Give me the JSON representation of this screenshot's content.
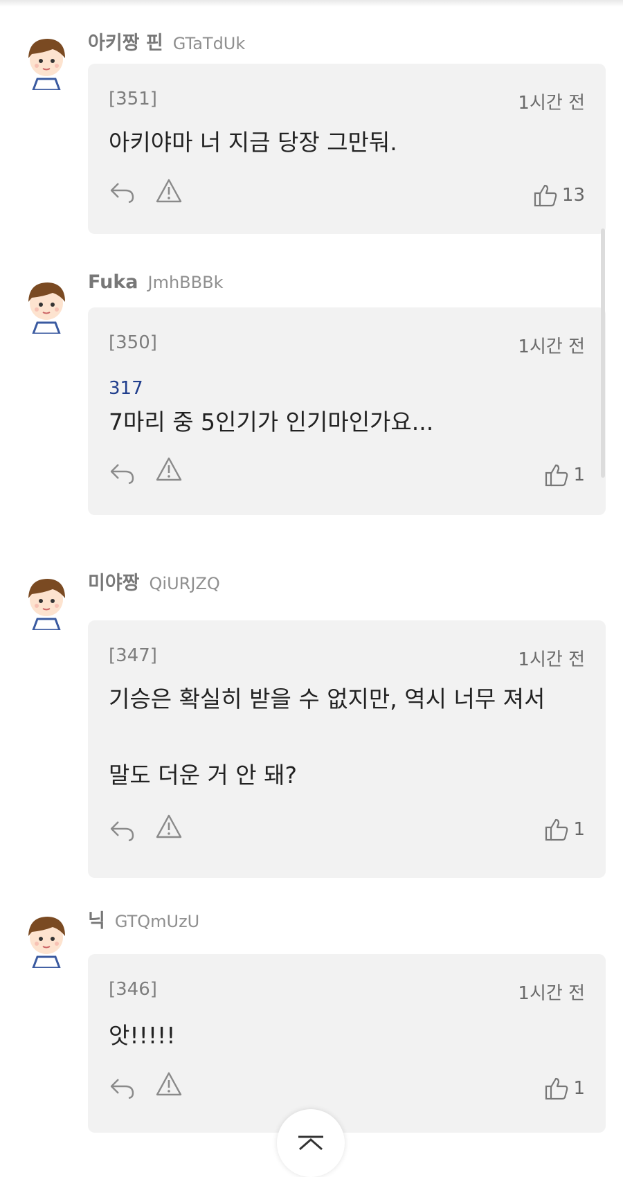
{
  "comments": [
    {
      "nickname": "아키짱 핀",
      "user_id": "GTaTdUk",
      "number": "[351]",
      "time": "1시간 전",
      "reply_to": "",
      "lines": [
        "아키야마 너 지금 당장 그만둬."
      ],
      "likes": "13"
    },
    {
      "nickname": "Fuka",
      "user_id": "JmhBBBk",
      "number": "[350]",
      "time": "1시간 전",
      "reply_to": "317",
      "lines": [
        "7마리 중 5인기가 인기마인가요..."
      ],
      "likes": "1"
    },
    {
      "nickname": "미야짱",
      "user_id": "QiURJZQ",
      "number": "[347]",
      "time": "1시간 전",
      "reply_to": "",
      "lines": [
        "기승은 확실히 받을 수 없지만, 역시 너무 져서",
        "",
        "말도 더운 거 안 돼?"
      ],
      "likes": "1"
    },
    {
      "nickname": "닉",
      "user_id": "GTQmUzU",
      "number": "[346]",
      "time": "1시간 전",
      "reply_to": "",
      "lines": [
        "앗!!!!!"
      ],
      "likes": "1"
    }
  ],
  "icons": {
    "reply": "reply-arrow-icon",
    "report": "warning-triangle-icon",
    "like": "thumbs-up-icon",
    "scroll_top": "chevron-up-icon"
  },
  "colors": {
    "card_bg": "#f2f2f2",
    "reply_ref": "#1f3d8c",
    "nickname": "#777777"
  }
}
